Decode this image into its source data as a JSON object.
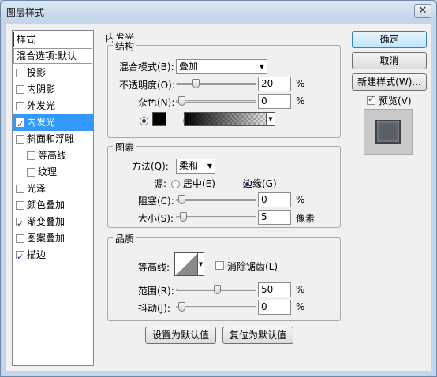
{
  "window": {
    "title": "图层样式",
    "close_glyph": "✕"
  },
  "sidebar": {
    "header": "样式",
    "blend_options": "混合选项:默认",
    "items": [
      {
        "label": "投影",
        "checked": false,
        "sub": false,
        "selected": false
      },
      {
        "label": "内阴影",
        "checked": false,
        "sub": false,
        "selected": false
      },
      {
        "label": "外发光",
        "checked": false,
        "sub": false,
        "selected": false
      },
      {
        "label": "内发光",
        "checked": true,
        "sub": false,
        "selected": true
      },
      {
        "label": "斜面和浮雕",
        "checked": false,
        "sub": false,
        "selected": false
      },
      {
        "label": "等高线",
        "checked": false,
        "sub": true,
        "selected": false
      },
      {
        "label": "纹理",
        "checked": false,
        "sub": true,
        "selected": false
      },
      {
        "label": "光泽",
        "checked": false,
        "sub": false,
        "selected": false
      },
      {
        "label": "颜色叠加",
        "checked": false,
        "sub": false,
        "selected": false
      },
      {
        "label": "渐变叠加",
        "checked": true,
        "sub": false,
        "selected": false
      },
      {
        "label": "图案叠加",
        "checked": false,
        "sub": false,
        "selected": false
      },
      {
        "label": "描边",
        "checked": true,
        "sub": false,
        "selected": false
      }
    ]
  },
  "panel": {
    "title": "内发光",
    "structure": {
      "title": "结构",
      "blend_mode_label": "混合模式(B):",
      "blend_mode_value": "叠加",
      "opacity_label": "不透明度(O):",
      "opacity_value": "20",
      "opacity_unit": "%",
      "opacity_level": 0.2,
      "noise_label": "杂色(N):",
      "noise_value": "0",
      "noise_unit": "%",
      "noise_level": 0,
      "color_swatch": "#000000"
    },
    "elements": {
      "title": "图素",
      "method_label": "方法(Q):",
      "method_value": "柔和",
      "source_label": "源:",
      "source_center": "居中(E)",
      "source_edge": "边缘(G)",
      "choke_label": "阻塞(C):",
      "choke_value": "0",
      "choke_unit": "%",
      "choke_level": 0,
      "size_label": "大小(S):",
      "size_value": "5",
      "size_unit": "像素",
      "size_level": 0.02
    },
    "quality": {
      "title": "品质",
      "contour_label": "等高线:",
      "antialias_label": "消除锯齿(L)",
      "range_label": "范围(R):",
      "range_value": "50",
      "range_unit": "%",
      "range_level": 0.5,
      "jitter_label": "抖动(J):",
      "jitter_value": "0",
      "jitter_unit": "%",
      "jitter_level": 0
    },
    "make_default": "设置为默认值",
    "reset_default": "复位为默认值"
  },
  "actions": {
    "ok": "确定",
    "cancel": "取消",
    "new_style": "新建样式(W)...",
    "preview": "预览(V)",
    "preview_checked": true
  }
}
